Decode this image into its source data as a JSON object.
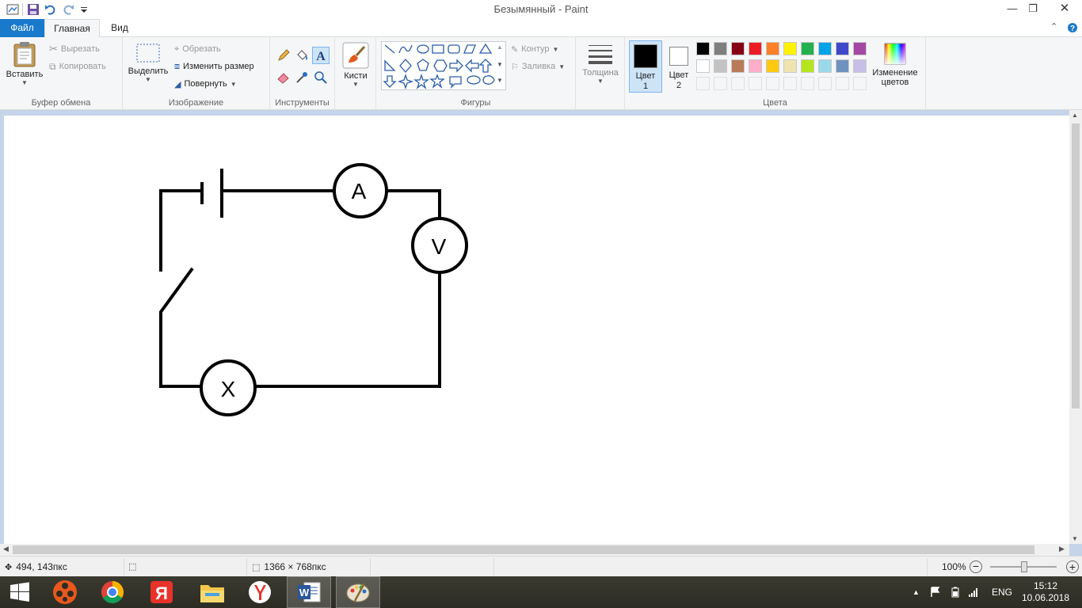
{
  "window": {
    "title": "Безымянный - Paint",
    "controls": [
      "minimize",
      "restore",
      "close"
    ]
  },
  "quick_access": [
    "save-icon",
    "undo-icon",
    "redo-icon",
    "customize-icon"
  ],
  "tabs": {
    "file": "Файл",
    "home": "Главная",
    "view": "Вид"
  },
  "ribbon": {
    "clipboard": {
      "label": "Буфер обмена",
      "paste": "Вставить",
      "cut": "Вырезать",
      "copy": "Копировать"
    },
    "image": {
      "label": "Изображение",
      "select": "Выделить",
      "crop": "Обрезать",
      "resize": "Изменить размер",
      "rotate": "Повернуть"
    },
    "tools": {
      "label": "Инструменты"
    },
    "brushes": {
      "label": "Кисти"
    },
    "shapes": {
      "label": "Фигуры",
      "outline": "Контур",
      "fill": "Заливка"
    },
    "size": {
      "label": "Толщина"
    },
    "colors": {
      "label": "Цвета",
      "color1": "Цвет\n1",
      "color1_a": "Цвет",
      "color1_b": "1",
      "color2_a": "Цвет",
      "color2_b": "2",
      "edit_a": "Изменение",
      "edit_b": "цветов",
      "color1_value": "#000000",
      "color2_value": "#ffffff",
      "palette_row1": [
        "#000000",
        "#7f7f7f",
        "#880015",
        "#ed1c24",
        "#ff7f27",
        "#fff200",
        "#22b14c",
        "#00a2e8",
        "#3f48cc",
        "#a349a4"
      ],
      "palette_row2": [
        "#ffffff",
        "#c3c3c3",
        "#b97a57",
        "#ffaec9",
        "#ffc90e",
        "#efe4b0",
        "#b5e61d",
        "#99d9ea",
        "#7092be",
        "#c8bfe7"
      ]
    }
  },
  "drawing": {
    "ammeter": "A",
    "voltmeter": "V",
    "unknown": "X"
  },
  "status": {
    "cursor_pos": "494, 143пкс",
    "selection_size": "",
    "image_size": "1366 × 768пкс",
    "zoom": "100%"
  },
  "taskbar": {
    "apps": [
      "start",
      "media-player",
      "chrome",
      "yandex",
      "file-explorer",
      "yandex-browser",
      "word",
      "paint"
    ],
    "language": "ENG",
    "time": "15:12",
    "date": "10.06.2018"
  }
}
